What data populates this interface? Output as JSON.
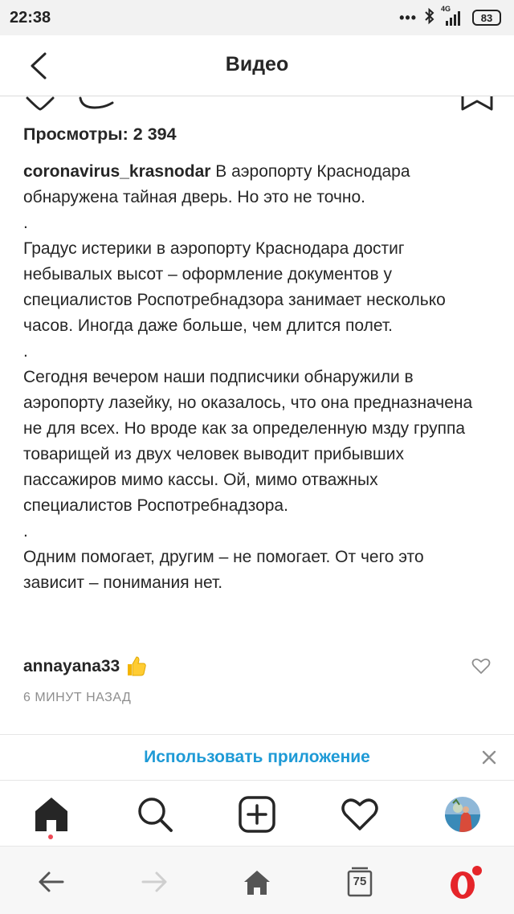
{
  "status_bar": {
    "time": "22:38",
    "dots": "•••",
    "network": "4G",
    "battery": "83"
  },
  "header": {
    "title": "Видео",
    "back_icon": "chevron-left-icon"
  },
  "post": {
    "views": "Просмотры: 2 394",
    "author": "coronavirus_krasnodar",
    "caption": "В аэропорту Краснодара обнаружена тайная дверь. Но это не точно.\n.\nГрадус истерики в аэропорту Краснодара достиг небывалых высот – оформление документов у специалистов Роспотребнадзора занимает несколько часов. Иногда даже больше, чем длится полет.\n.\nСегодня вечером наши подписчики обнаружили в аэропорту лазейку, но оказалось, что она предназначена не для всех. Но вроде как за определенную мзду группа товарищей из двух человек выводит прибывших пассажиров мимо кассы. Ой, мимо отважных специалистов Роспотребнадзора.\n.\nОдним помогает, другим – не помогает. От чего это зависит – понимания нет."
  },
  "comment": {
    "user": "annayana33",
    "emoji": "thumbs-up-icon"
  },
  "timestamp": "6 МИНУТ НАЗАД",
  "use_app": {
    "label": "Использовать приложение"
  },
  "tabbar": {
    "items": [
      "home-icon",
      "search-icon",
      "new-post-icon",
      "activity-heart-icon",
      "profile-avatar"
    ]
  },
  "browser": {
    "tabs_count": "75",
    "items": [
      "back-arrow-icon",
      "forward-arrow-icon",
      "home-icon",
      "tabs-icon",
      "opera-icon"
    ]
  },
  "colors": {
    "accent": "#1e9ad6",
    "notification": "#ed4956",
    "opera_red": "#e5252a",
    "text": "#262626",
    "muted": "#8e8e8e"
  }
}
